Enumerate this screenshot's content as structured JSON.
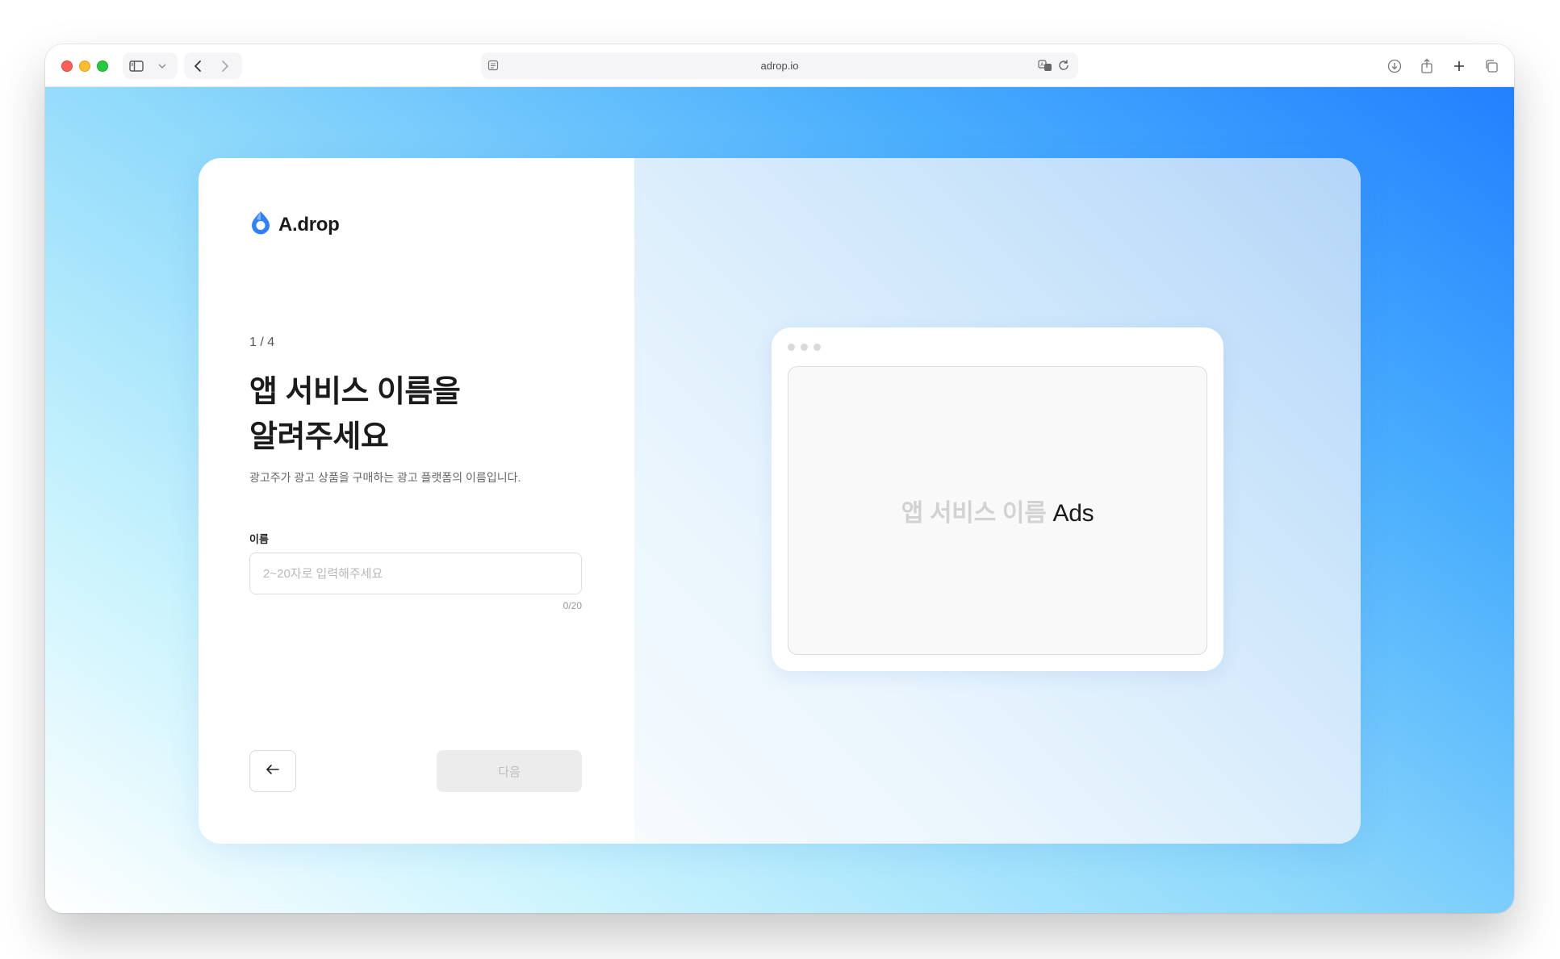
{
  "browser": {
    "url": "adrop.io"
  },
  "brand": {
    "name": "A.drop",
    "accent": "#2f7fff"
  },
  "form": {
    "step": "1 / 4",
    "title_line1": "앱 서비스 이름을",
    "title_line2": "알려주세요",
    "subtitle": "광고주가 광고 상품을 구매하는 광고 플랫폼의 이름입니다.",
    "name_label": "이름",
    "name_value": "",
    "name_placeholder": "2~20자로 입력해주세요",
    "counter": "0/20",
    "next_label": "다음"
  },
  "preview": {
    "name_placeholder": "앱 서비스 이름",
    "suffix": "Ads"
  },
  "icons": [
    "sidebar-icon",
    "chevron-down-icon",
    "back-arrow-icon",
    "forward-arrow-icon",
    "reader-icon",
    "translate-icon",
    "reload-icon",
    "download-icon",
    "share-icon",
    "plus-icon",
    "tabs-icon",
    "drop-logo-icon",
    "arrow-left-icon"
  ]
}
